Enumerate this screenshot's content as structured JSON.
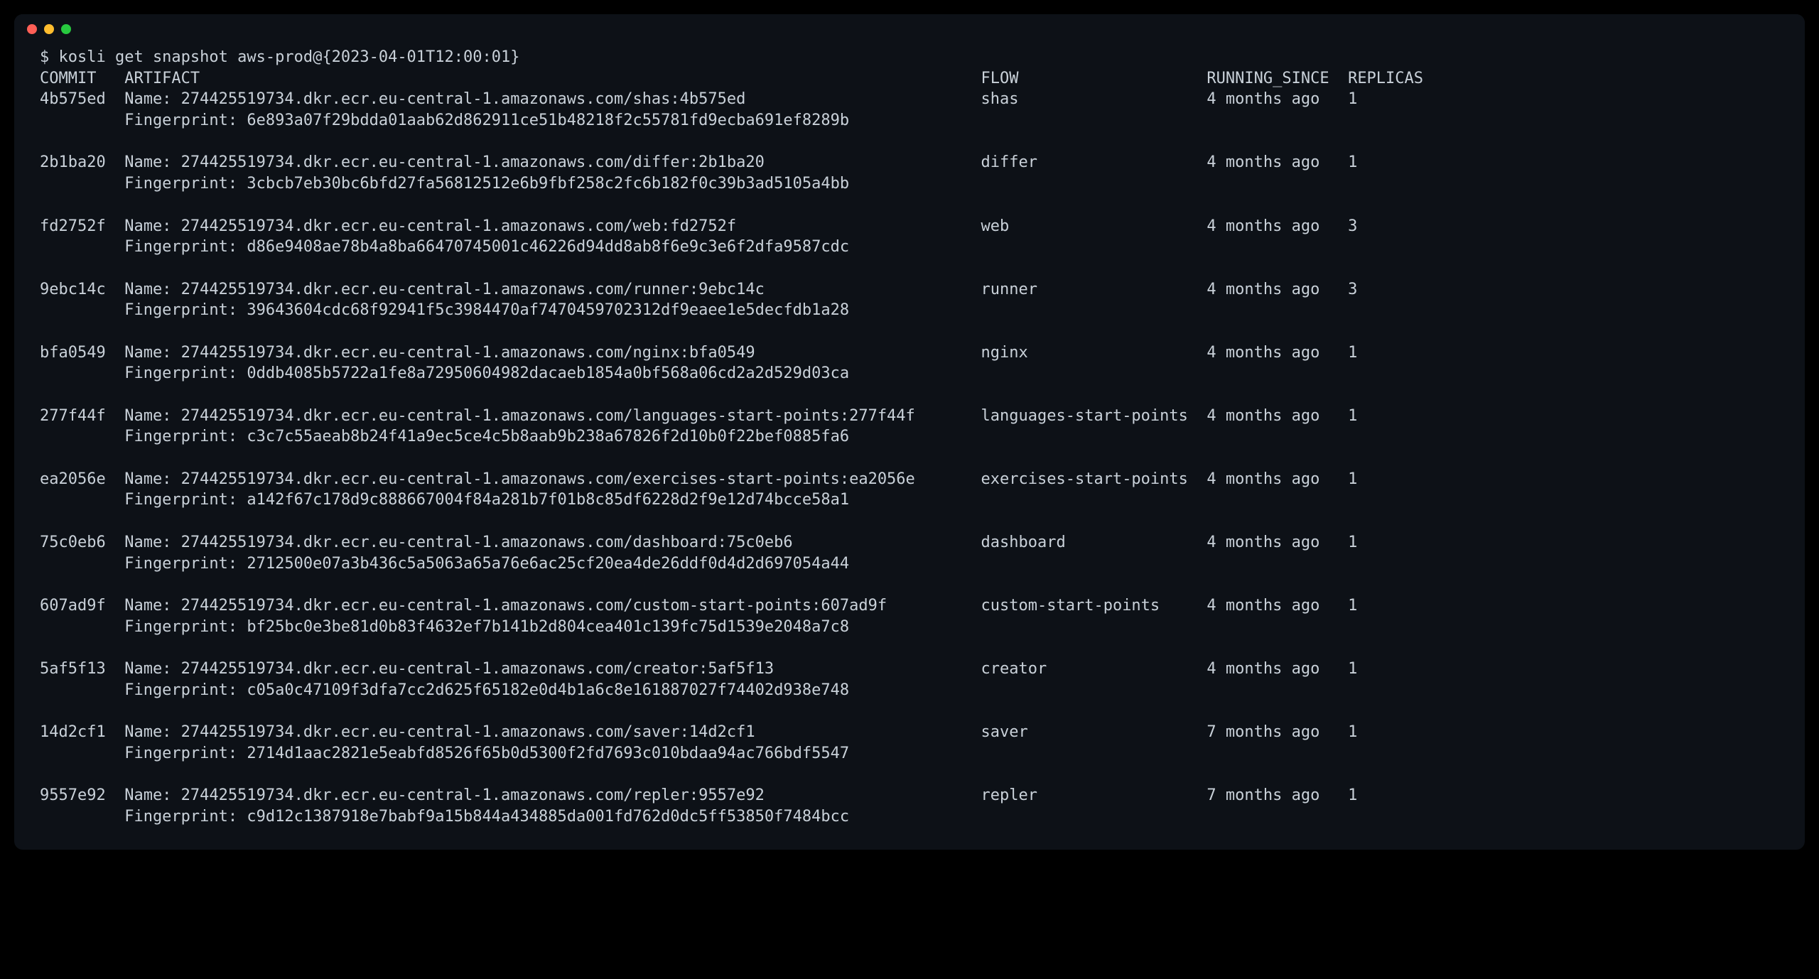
{
  "prompt": "$ kosli get snapshot aws-prod@{2023-04-01T12:00:01}",
  "headers": {
    "commit": "COMMIT",
    "artifact": "ARTIFACT",
    "flow": "FLOW",
    "running_since": "RUNNING_SINCE",
    "replicas": "REPLICAS"
  },
  "labels": {
    "name": "Name:",
    "fingerprint": "Fingerprint:"
  },
  "columns": {
    "commit_w": 9,
    "artifact_w": 91,
    "flow_w": 24,
    "running_w": 15
  },
  "rows": [
    {
      "commit": "4b575ed",
      "name": "274425519734.dkr.ecr.eu-central-1.amazonaws.com/shas:4b575ed",
      "fingerprint": "6e893a07f29bdda01aab62d862911ce51b48218f2c55781fd9ecba691ef8289b",
      "flow": "shas",
      "running_since": "4 months ago",
      "replicas": "1"
    },
    {
      "commit": "2b1ba20",
      "name": "274425519734.dkr.ecr.eu-central-1.amazonaws.com/differ:2b1ba20",
      "fingerprint": "3cbcb7eb30bc6bfd27fa56812512e6b9fbf258c2fc6b182f0c39b3ad5105a4bb",
      "flow": "differ",
      "running_since": "4 months ago",
      "replicas": "1"
    },
    {
      "commit": "fd2752f",
      "name": "274425519734.dkr.ecr.eu-central-1.amazonaws.com/web:fd2752f",
      "fingerprint": "d86e9408ae78b4a8ba66470745001c46226d94dd8ab8f6e9c3e6f2dfa9587cdc",
      "flow": "web",
      "running_since": "4 months ago",
      "replicas": "3"
    },
    {
      "commit": "9ebc14c",
      "name": "274425519734.dkr.ecr.eu-central-1.amazonaws.com/runner:9ebc14c",
      "fingerprint": "39643604cdc68f92941f5c3984470af7470459702312df9eaee1e5decfdb1a28",
      "flow": "runner",
      "running_since": "4 months ago",
      "replicas": "3"
    },
    {
      "commit": "bfa0549",
      "name": "274425519734.dkr.ecr.eu-central-1.amazonaws.com/nginx:bfa0549",
      "fingerprint": "0ddb4085b5722a1fe8a72950604982dacaeb1854a0bf568a06cd2a2d529d03ca",
      "flow": "nginx",
      "running_since": "4 months ago",
      "replicas": "1"
    },
    {
      "commit": "277f44f",
      "name": "274425519734.dkr.ecr.eu-central-1.amazonaws.com/languages-start-points:277f44f",
      "fingerprint": "c3c7c55aeab8b24f41a9ec5ce4c5b8aab9b238a67826f2d10b0f22bef0885fa6",
      "flow": "languages-start-points",
      "running_since": "4 months ago",
      "replicas": "1"
    },
    {
      "commit": "ea2056e",
      "name": "274425519734.dkr.ecr.eu-central-1.amazonaws.com/exercises-start-points:ea2056e",
      "fingerprint": "a142f67c178d9c888667004f84a281b7f01b8c85df6228d2f9e12d74bcce58a1",
      "flow": "exercises-start-points",
      "running_since": "4 months ago",
      "replicas": "1"
    },
    {
      "commit": "75c0eb6",
      "name": "274425519734.dkr.ecr.eu-central-1.amazonaws.com/dashboard:75c0eb6",
      "fingerprint": "2712500e07a3b436c5a5063a65a76e6ac25cf20ea4de26ddf0d4d2d697054a44",
      "flow": "dashboard",
      "running_since": "4 months ago",
      "replicas": "1"
    },
    {
      "commit": "607ad9f",
      "name": "274425519734.dkr.ecr.eu-central-1.amazonaws.com/custom-start-points:607ad9f",
      "fingerprint": "bf25bc0e3be81d0b83f4632ef7b141b2d804cea401c139fc75d1539e2048a7c8",
      "flow": "custom-start-points",
      "running_since": "4 months ago",
      "replicas": "1"
    },
    {
      "commit": "5af5f13",
      "name": "274425519734.dkr.ecr.eu-central-1.amazonaws.com/creator:5af5f13",
      "fingerprint": "c05a0c47109f3dfa7cc2d625f65182e0d4b1a6c8e161887027f74402d938e748",
      "flow": "creator",
      "running_since": "4 months ago",
      "replicas": "1"
    },
    {
      "commit": "14d2cf1",
      "name": "274425519734.dkr.ecr.eu-central-1.amazonaws.com/saver:14d2cf1",
      "fingerprint": "2714d1aac2821e5eabfd8526f65b0d5300f2fd7693c010bdaa94ac766bdf5547",
      "flow": "saver",
      "running_since": "7 months ago",
      "replicas": "1"
    },
    {
      "commit": "9557e92",
      "name": "274425519734.dkr.ecr.eu-central-1.amazonaws.com/repler:9557e92",
      "fingerprint": "c9d12c1387918e7babf9a15b844a434885da001fd762d0dc5ff53850f7484bcc",
      "flow": "repler",
      "running_since": "7 months ago",
      "replicas": "1"
    }
  ]
}
